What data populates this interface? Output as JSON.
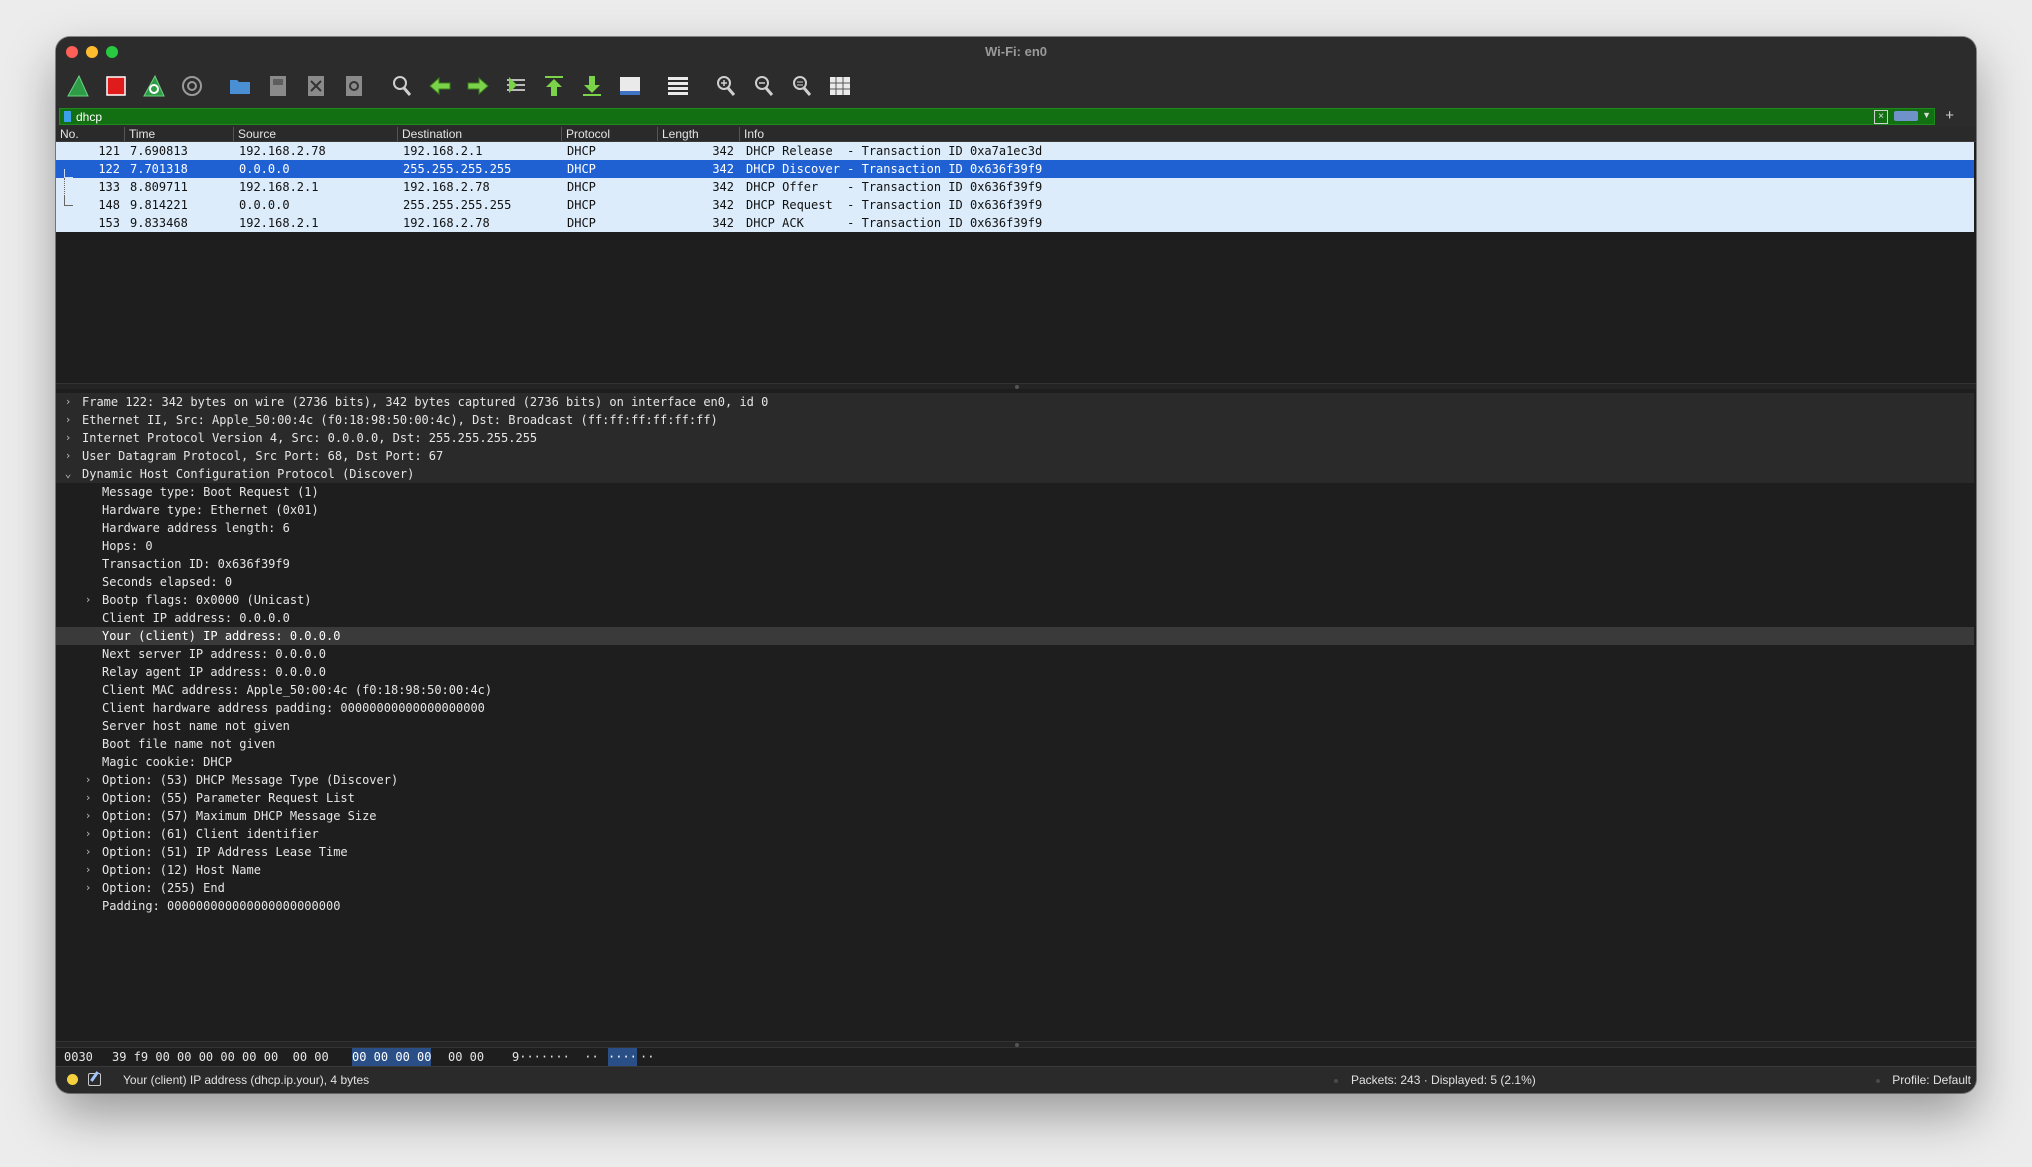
{
  "window": {
    "title": "Wi-Fi: en0"
  },
  "colors": {
    "filter_valid": "#127012",
    "selection": "#1f61d3",
    "row_bg": "#dcecfb"
  },
  "toolbar": {
    "icons": [
      "shark-fin-start-icon",
      "stop-square-icon",
      "shark-fin-restart-icon",
      "capture-options-gear-icon",
      "open-folder-icon",
      "save-file-icon",
      "close-file-icon",
      "reload-file-icon",
      "find-packet-magnifier-icon",
      "go-back-arrow-icon",
      "go-forward-arrow-icon",
      "go-to-packet-icon",
      "first-packet-icon",
      "last-packet-icon",
      "auto-scroll-icon",
      "colorize-list-icon",
      "zoom-in-icon",
      "zoom-out-icon",
      "normal-size-icon",
      "resize-columns-icon"
    ]
  },
  "filter": {
    "value": "dhcp",
    "add_label": "+"
  },
  "packet_list": {
    "columns": [
      "No.",
      "Time",
      "Source",
      "Destination",
      "Protocol",
      "Length",
      "Info"
    ],
    "rows": [
      {
        "no": "121",
        "time": "7.690813",
        "source": "192.168.2.78",
        "destination": "192.168.2.1",
        "protocol": "DHCP",
        "length": "342",
        "info": "DHCP Release  - Transaction ID 0xa7a1ec3d",
        "selected": false
      },
      {
        "no": "122",
        "time": "7.701318",
        "source": "0.0.0.0",
        "destination": "255.255.255.255",
        "protocol": "DHCP",
        "length": "342",
        "info": "DHCP Discover - Transaction ID 0x636f39f9",
        "selected": true
      },
      {
        "no": "133",
        "time": "8.809711",
        "source": "192.168.2.1",
        "destination": "192.168.2.78",
        "protocol": "DHCP",
        "length": "342",
        "info": "DHCP Offer    - Transaction ID 0x636f39f9",
        "selected": false
      },
      {
        "no": "148",
        "time": "9.814221",
        "source": "0.0.0.0",
        "destination": "255.255.255.255",
        "protocol": "DHCP",
        "length": "342",
        "info": "DHCP Request  - Transaction ID 0x636f39f9",
        "selected": false
      },
      {
        "no": "153",
        "time": "9.833468",
        "source": "192.168.2.1",
        "destination": "192.168.2.78",
        "protocol": "DHCP",
        "length": "342",
        "info": "DHCP ACK      - Transaction ID 0x636f39f9",
        "selected": false
      }
    ]
  },
  "details": [
    {
      "text": "Frame 122: 342 bytes on wire (2736 bits), 342 bytes captured (2736 bits) on interface en0, id 0",
      "level": 0,
      "arrow": "collapsed"
    },
    {
      "text": "Ethernet II, Src: Apple_50:00:4c (f0:18:98:50:00:4c), Dst: Broadcast (ff:ff:ff:ff:ff:ff)",
      "level": 0,
      "arrow": "collapsed"
    },
    {
      "text": "Internet Protocol Version 4, Src: 0.0.0.0, Dst: 255.255.255.255",
      "level": 0,
      "arrow": "collapsed"
    },
    {
      "text": "User Datagram Protocol, Src Port: 68, Dst Port: 67",
      "level": 0,
      "arrow": "collapsed"
    },
    {
      "text": "Dynamic Host Configuration Protocol (Discover)",
      "level": 0,
      "arrow": "expanded"
    },
    {
      "text": "Message type: Boot Request (1)",
      "level": 1,
      "arrow": "none"
    },
    {
      "text": "Hardware type: Ethernet (0x01)",
      "level": 1,
      "arrow": "none"
    },
    {
      "text": "Hardware address length: 6",
      "level": 1,
      "arrow": "none"
    },
    {
      "text": "Hops: 0",
      "level": 1,
      "arrow": "none"
    },
    {
      "text": "Transaction ID: 0x636f39f9",
      "level": 1,
      "arrow": "none"
    },
    {
      "text": "Seconds elapsed: 0",
      "level": 1,
      "arrow": "none"
    },
    {
      "text": "Bootp flags: 0x0000 (Unicast)",
      "level": 1,
      "arrow": "collapsed"
    },
    {
      "text": "Client IP address: 0.0.0.0",
      "level": 1,
      "arrow": "none"
    },
    {
      "text": "Your (client) IP address: 0.0.0.0",
      "level": 1,
      "arrow": "none",
      "highlight": true
    },
    {
      "text": "Next server IP address: 0.0.0.0",
      "level": 1,
      "arrow": "none"
    },
    {
      "text": "Relay agent IP address: 0.0.0.0",
      "level": 1,
      "arrow": "none"
    },
    {
      "text": "Client MAC address: Apple_50:00:4c (f0:18:98:50:00:4c)",
      "level": 1,
      "arrow": "none"
    },
    {
      "text": "Client hardware address padding: 00000000000000000000",
      "level": 1,
      "arrow": "none"
    },
    {
      "text": "Server host name not given",
      "level": 1,
      "arrow": "none"
    },
    {
      "text": "Boot file name not given",
      "level": 1,
      "arrow": "none"
    },
    {
      "text": "Magic cookie: DHCP",
      "level": 1,
      "arrow": "none"
    },
    {
      "text": "Option: (53) DHCP Message Type (Discover)",
      "level": 1,
      "arrow": "collapsed"
    },
    {
      "text": "Option: (55) Parameter Request List",
      "level": 1,
      "arrow": "collapsed"
    },
    {
      "text": "Option: (57) Maximum DHCP Message Size",
      "level": 1,
      "arrow": "collapsed"
    },
    {
      "text": "Option: (61) Client identifier",
      "level": 1,
      "arrow": "collapsed"
    },
    {
      "text": "Option: (51) IP Address Lease Time",
      "level": 1,
      "arrow": "collapsed"
    },
    {
      "text": "Option: (12) Host Name",
      "level": 1,
      "arrow": "collapsed"
    },
    {
      "text": "Option: (255) End",
      "level": 1,
      "arrow": "collapsed"
    },
    {
      "text": "Padding: 000000000000000000000000",
      "level": 1,
      "arrow": "none"
    }
  ],
  "bytes": {
    "offset": "0030",
    "hex_pre": "39 f9 00 00 00 00 00 00  00 00",
    "hex_sel": "00 00 00 00",
    "hex_post": "00 00",
    "ascii_pre": "9·······  ··",
    "ascii_sel": "····",
    "ascii_post": "··"
  },
  "status": {
    "field_info": "Your (client) IP address (dhcp.ip.your), 4 bytes",
    "packets": "Packets: 243 · Displayed: 5 (2.1%)",
    "profile": "Profile: Default"
  }
}
